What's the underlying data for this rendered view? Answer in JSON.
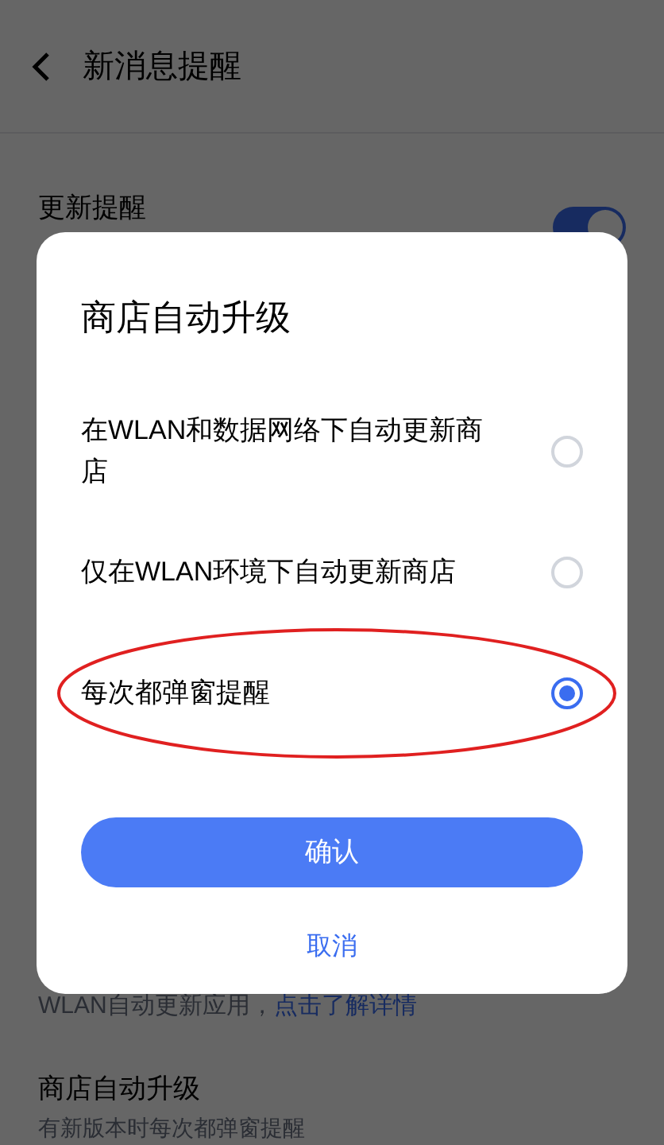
{
  "header": {
    "title": "新消息提醒"
  },
  "settings": [
    {
      "kind": "toggle",
      "title": "更新提醒",
      "on": true
    },
    {
      "kind": "note",
      "text": "WLAN自动更新应用，",
      "link": "点击了解详情"
    },
    {
      "kind": "item",
      "title": "商店自动升级",
      "subtitle": "有新版本时每次都弹窗提醒"
    }
  ],
  "dialog": {
    "title": "商店自动升级",
    "options": [
      {
        "label": "在WLAN和数据网络下自动更新商店",
        "selected": false,
        "circled": false
      },
      {
        "label": "仅在WLAN环境下自动更新商店",
        "selected": false,
        "circled": false
      },
      {
        "label": "每次都弹窗提醒",
        "selected": true,
        "circled": true
      }
    ],
    "confirm": "确认",
    "cancel": "取消"
  }
}
